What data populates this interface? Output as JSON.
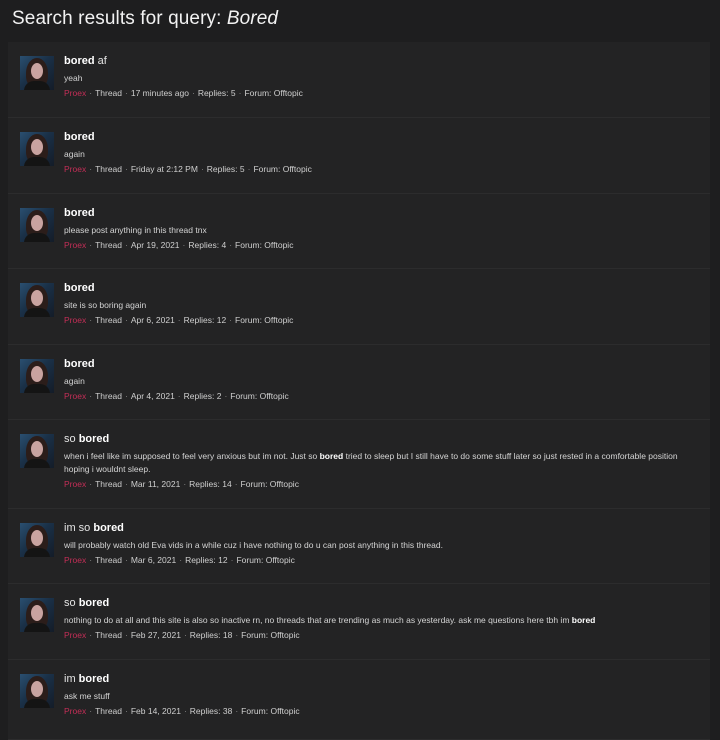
{
  "page": {
    "title_prefix": "Search results for query: ",
    "query": "Bored"
  },
  "results": [
    {
      "title_pre": "",
      "title_bold": "bored",
      "title_post": " af",
      "snippet_pre": "yeah",
      "snippet_bold": "",
      "snippet_post": "",
      "author": "Proex",
      "type": "Thread",
      "date": "17 minutes ago",
      "replies": "Replies: 5",
      "forum": "Forum: Offtopic",
      "height": 76
    },
    {
      "title_pre": "",
      "title_bold": "bored",
      "title_post": "",
      "snippet_pre": "again",
      "snippet_bold": "",
      "snippet_post": "",
      "author": "Proex",
      "type": "Thread",
      "date": "Friday at 2:12 PM",
      "replies": "Replies: 5",
      "forum": "Forum: Offtopic",
      "height": 76
    },
    {
      "title_pre": "",
      "title_bold": "bored",
      "title_post": "",
      "snippet_pre": "please post anything in this thread tnx",
      "snippet_bold": "",
      "snippet_post": "",
      "author": "Proex",
      "type": "Thread",
      "date": "Apr 19, 2021",
      "replies": "Replies: 4",
      "forum": "Forum: Offtopic",
      "height": 75
    },
    {
      "title_pre": "",
      "title_bold": "bored",
      "title_post": "",
      "snippet_pre": "site is so boring again",
      "snippet_bold": "",
      "snippet_post": "",
      "author": "Proex",
      "type": "Thread",
      "date": "Apr 6, 2021",
      "replies": "Replies: 12",
      "forum": "Forum: Offtopic",
      "height": 76
    },
    {
      "title_pre": "",
      "title_bold": "bored",
      "title_post": "",
      "snippet_pre": "again",
      "snippet_bold": "",
      "snippet_post": "",
      "author": "Proex",
      "type": "Thread",
      "date": "Apr 4, 2021",
      "replies": "Replies: 2",
      "forum": "Forum: Offtopic",
      "height": 75
    },
    {
      "title_pre": "so ",
      "title_bold": "bored",
      "title_post": "",
      "snippet_pre": "when i feel like im supposed to feel very anxious but im not. Just so ",
      "snippet_bold": "bored",
      "snippet_post": " tried to sleep but I still have to do some stuff later so just rested in a comfortable position hoping i wouldnt sleep.",
      "author": "Proex",
      "type": "Thread",
      "date": "Mar 11, 2021",
      "replies": "Replies: 14",
      "forum": "Forum: Offtopic",
      "height": 89
    },
    {
      "title_pre": "im so ",
      "title_bold": "bored",
      "title_post": "",
      "snippet_pre": "will probably watch old Eva vids in a while cuz i have nothing to do u can post anything in this thread.",
      "snippet_bold": "",
      "snippet_post": "",
      "author": "Proex",
      "type": "Thread",
      "date": "Mar 6, 2021",
      "replies": "Replies: 12",
      "forum": "Forum: Offtopic",
      "height": 75
    },
    {
      "title_pre": "so ",
      "title_bold": "bored",
      "title_post": "",
      "snippet_pre": "nothing to do at all and this site is also so inactive rn, no threads that are trending as much as yesterday. ask me questions here tbh im ",
      "snippet_bold": "bored",
      "snippet_post": "",
      "author": "Proex",
      "type": "Thread",
      "date": "Feb 27, 2021",
      "replies": "Replies: 18",
      "forum": "Forum: Offtopic",
      "height": 76
    },
    {
      "title_pre": "im ",
      "title_bold": "bored",
      "title_post": "",
      "snippet_pre": "ask me stuff",
      "snippet_bold": "",
      "snippet_post": "",
      "author": "Proex",
      "type": "Thread",
      "date": "Feb 14, 2021",
      "replies": "Replies: 38",
      "forum": "Forum: Offtopic",
      "height": 80
    }
  ]
}
